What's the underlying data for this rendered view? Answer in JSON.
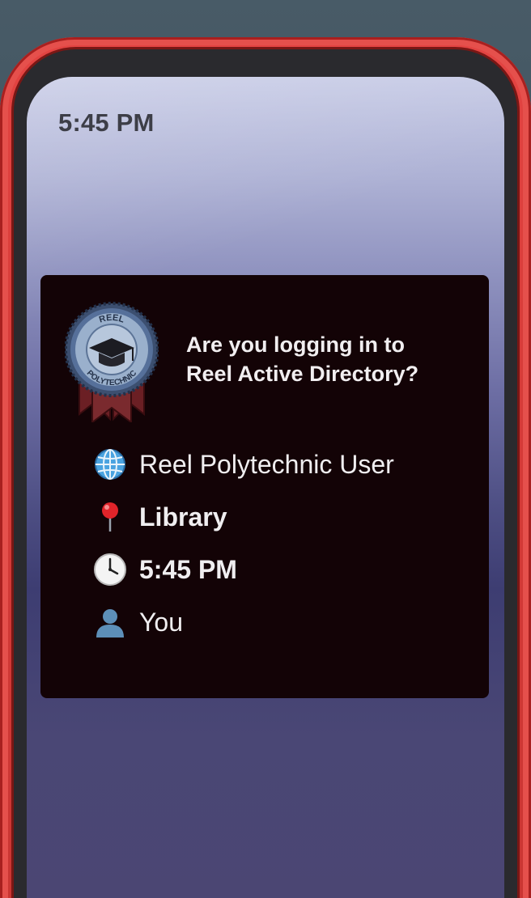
{
  "status_bar": {
    "time": "5:45 PM"
  },
  "login_card": {
    "logo": {
      "top_text": "REEL",
      "bottom_text": "POLYTECHNIC",
      "icon": "graduation-cap-icon"
    },
    "prompt_line1": "Are you logging in to",
    "prompt_line2": "Reel Active Directory?",
    "details": [
      {
        "icon": "globe-icon",
        "text": "Reel Polytechnic User"
      },
      {
        "icon": "pushpin-icon",
        "text": "Library"
      },
      {
        "icon": "clock-icon",
        "text": "5:45 PM"
      },
      {
        "icon": "person-silhouette-icon",
        "text": "You"
      }
    ]
  },
  "colors": {
    "frame": "#d63b38",
    "card_background": "#130306",
    "card_text": "#f0eef0",
    "status_text": "#3d3e47"
  }
}
